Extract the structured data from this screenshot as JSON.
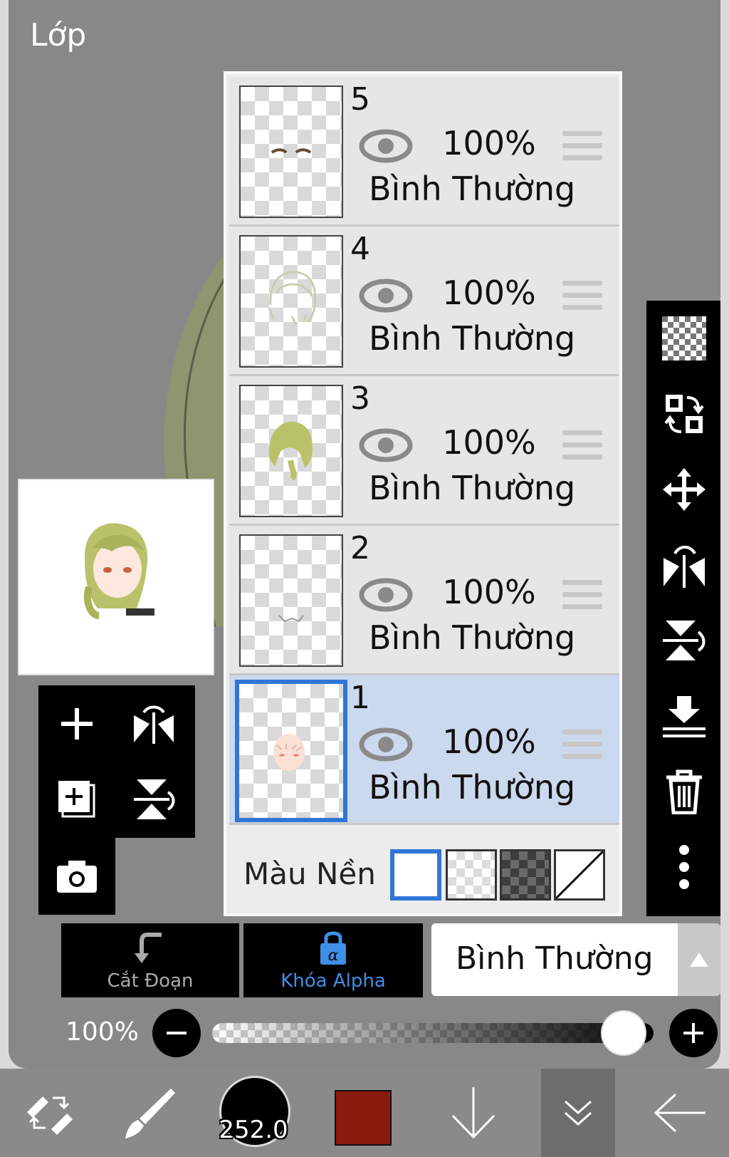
{
  "panel": {
    "title": "Lớp"
  },
  "layers": [
    {
      "number": "5",
      "opacity": "100%",
      "blend": "Bình Thường",
      "selected": false
    },
    {
      "number": "4",
      "opacity": "100%",
      "blend": "Bình Thường",
      "selected": false
    },
    {
      "number": "3",
      "opacity": "100%",
      "blend": "Bình Thường",
      "selected": false
    },
    {
      "number": "2",
      "opacity": "100%",
      "blend": "Bình Thường",
      "selected": false
    },
    {
      "number": "1",
      "opacity": "100%",
      "blend": "Bình Thường",
      "selected": true
    }
  ],
  "background": {
    "label": "Màu Nền",
    "options": [
      "white",
      "light-checker",
      "dark-checker",
      "none"
    ],
    "selected": "white"
  },
  "left_tools": [
    "add-layer-icon",
    "flip-horizontal-icon",
    "duplicate-layer-icon",
    "flip-vertical-icon",
    "camera-icon"
  ],
  "right_tools": [
    "transparency-icon",
    "swap-icon",
    "move-icon",
    "flip-horizontal-icon",
    "flip-vertical-icon",
    "merge-down-icon",
    "trash-icon",
    "more-vertical-icon"
  ],
  "controls": {
    "clipping_label": "Cắt Đoạn",
    "alpha_lock_label": "Khóa Alpha",
    "blend_mode": "Bình Thường",
    "opacity_label": "100%",
    "opacity_value": 1.0
  },
  "bottom_bar": {
    "brush_size": "252.0",
    "color": "#8b1a0f",
    "accent": "#2f76d6"
  }
}
